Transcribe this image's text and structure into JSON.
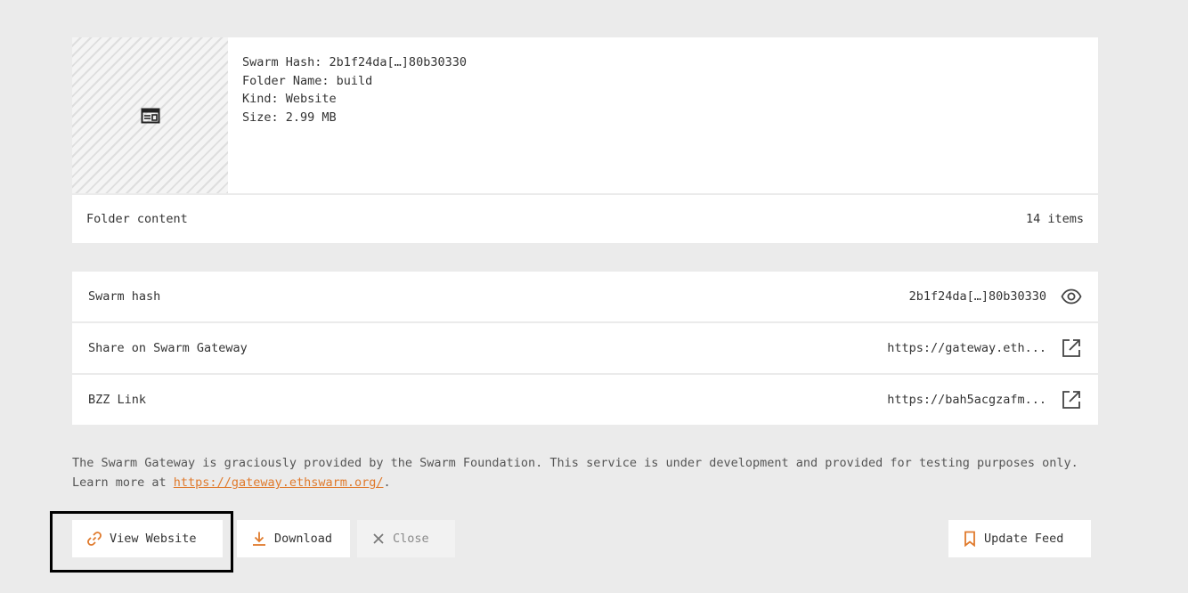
{
  "details": {
    "hash": "Swarm Hash: 2b1f24da[…]80b30330",
    "folder": "Folder Name: build",
    "kind": "Kind: Website",
    "size": "Size: 2.99 MB"
  },
  "folder_content": {
    "label": "Folder content",
    "count": "14 items"
  },
  "rows": [
    {
      "label": "Swarm hash",
      "value": "2b1f24da[…]80b30330",
      "icon": "eye-icon"
    },
    {
      "label": "Share on Swarm Gateway",
      "value": "https://gateway.eth...",
      "icon": "external-link-icon"
    },
    {
      "label": "BZZ Link",
      "value": "https://bah5acgzafm...",
      "icon": "external-link-icon"
    }
  ],
  "disclaimer": {
    "text_before": "The Swarm Gateway is graciously provided by the Swarm Foundation. This service is under development and provided for testing purposes only. Learn more at ",
    "link": "https://gateway.ethswarm.org/",
    "text_after": "."
  },
  "buttons": {
    "view_website": "View Website",
    "download": "Download",
    "close": "Close",
    "update_feed": "Update Feed"
  },
  "colors": {
    "accent": "#e07a2c",
    "background": "#ebebeb",
    "card": "#ffffff"
  }
}
